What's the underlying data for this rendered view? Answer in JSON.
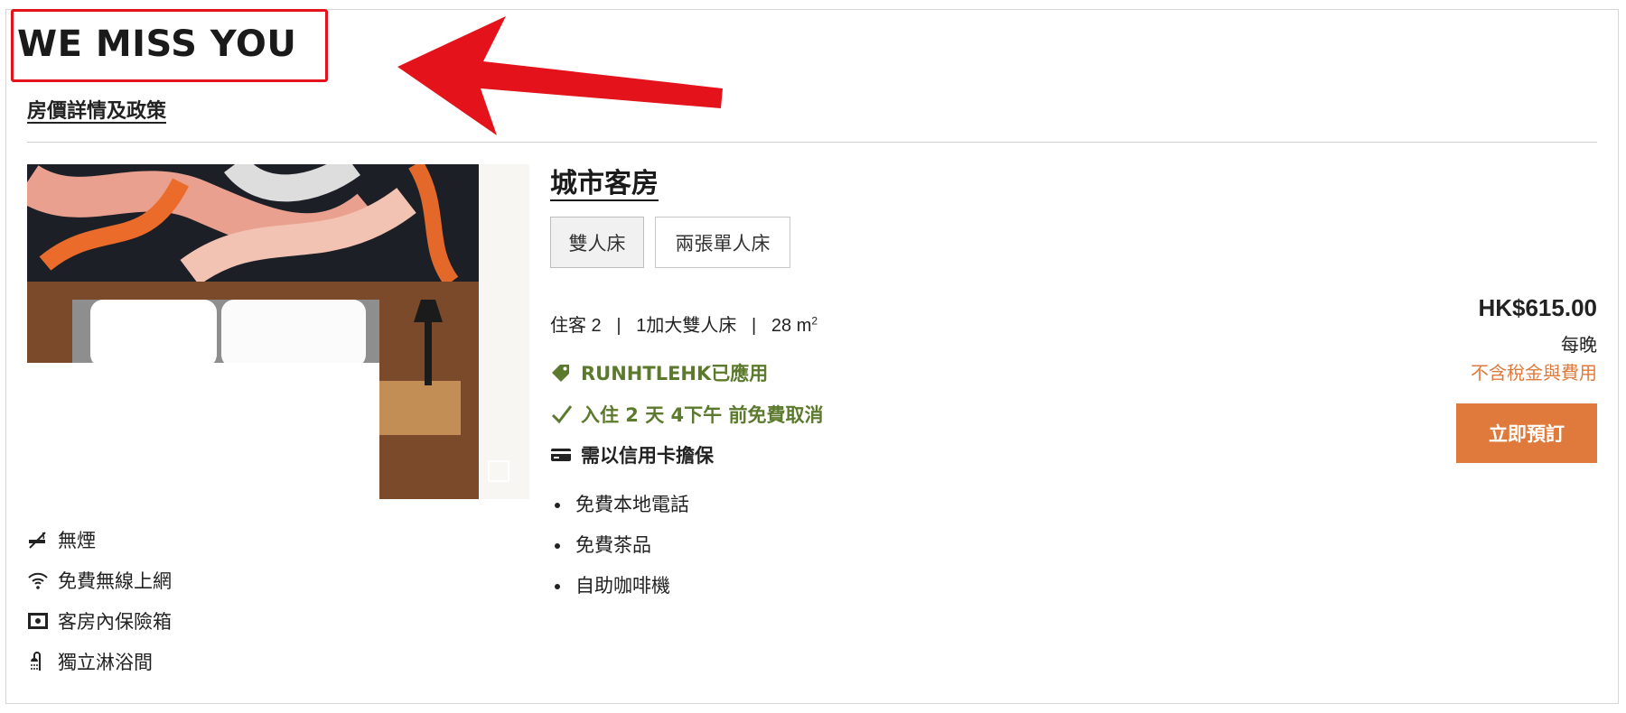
{
  "rate": {
    "heading": "WE MISS YOU",
    "policy_link": "房價詳情及政策"
  },
  "room": {
    "name": "城市客房",
    "bed_options": [
      "雙人床",
      "兩張單人床"
    ],
    "specs": {
      "guests": "住客 2",
      "bed": "1加大雙人床",
      "size": "28 m",
      "size_sup": "2"
    },
    "promo_code_text": "RUNHTLEHK已應用",
    "cancellation_text": "入住 2 天 4下午 前免費取消",
    "guarantee_text": "需以信用卡擔保",
    "features": [
      "免費本地電話",
      "免費茶品",
      "自助咖啡機"
    ],
    "amenities": [
      {
        "icon": "no-smoking-icon",
        "label": "無煙"
      },
      {
        "icon": "wifi-icon",
        "label": "免費無線上網"
      },
      {
        "icon": "safe-icon",
        "label": "客房內保險箱"
      },
      {
        "icon": "shower-icon",
        "label": "獨立淋浴間"
      }
    ]
  },
  "pricing": {
    "price": "HK$615.00",
    "per_night": "每晚",
    "tax_note": "不含稅金與費用",
    "book_label": "立即預訂"
  },
  "colors": {
    "accent_orange": "#e07a3c",
    "promo_green": "#5c7a2d",
    "annotation_red": "#e3121b"
  }
}
